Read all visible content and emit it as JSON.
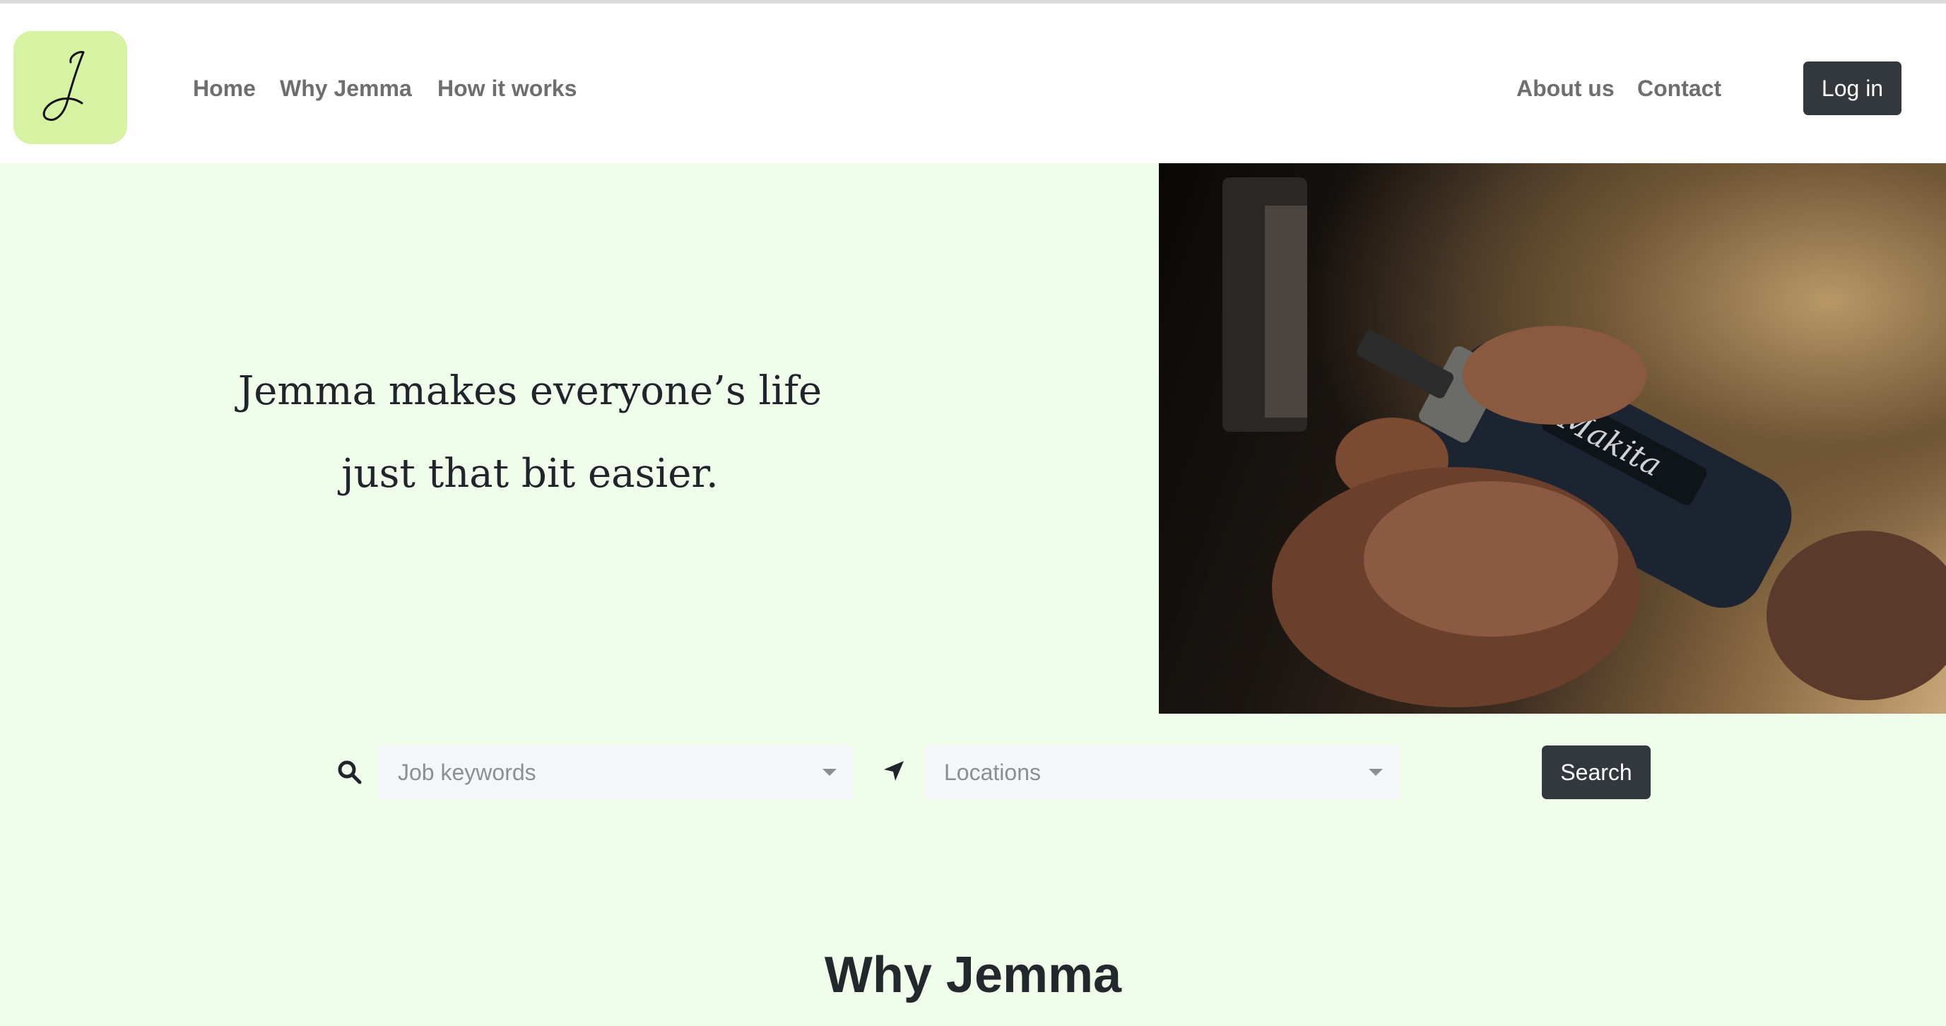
{
  "brand": {
    "logo_letter": "J",
    "logo_bg": "#d5f3a2"
  },
  "nav": {
    "left": [
      "Home",
      "Why Jemma",
      "How it works"
    ],
    "right": [
      "About us",
      "Contact"
    ],
    "login_label": "Log in"
  },
  "hero": {
    "line1": "Jemma makes everyone’s life",
    "line2": "just that bit easier.",
    "image_alt_text": "Makita"
  },
  "search": {
    "keywords_placeholder": "Job keywords",
    "locations_placeholder": "Locations",
    "button_label": "Search"
  },
  "section": {
    "title": "Why Jemma"
  },
  "colors": {
    "page_bg": "#f0fdea",
    "dark_button": "#32383e",
    "nav_text": "#6e6e6e",
    "select_bg": "#f5f6f8"
  },
  "icons": [
    "search-icon",
    "location-arrow-icon",
    "chevron-down-icon"
  ]
}
